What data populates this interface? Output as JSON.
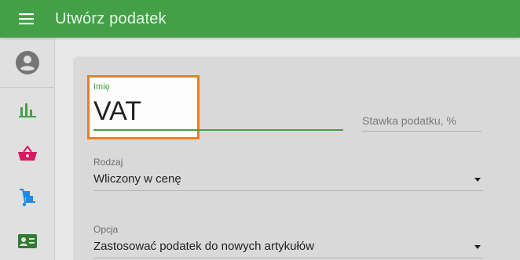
{
  "header": {
    "title": "Utwórz podatek",
    "menu_icon": "hamburger-menu-icon",
    "background_color": "#43a047"
  },
  "sidebar": {
    "avatar_icon": "account-circle-icon",
    "items": [
      {
        "icon": "bar-chart-icon",
        "color": "#43a047"
      },
      {
        "icon": "shopping-basket-icon",
        "color": "#d81b60"
      },
      {
        "icon": "hand-truck-icon",
        "color": "#1e88e5"
      },
      {
        "icon": "contact-card-icon",
        "color": "#2e7d32"
      }
    ]
  },
  "form": {
    "name": {
      "label": "Imię",
      "value": "VAT"
    },
    "rate": {
      "placeholder": "Stawka podatku, %"
    },
    "type": {
      "label": "Rodzaj",
      "value": "Wliczony w cenę"
    },
    "option": {
      "label": "Opcja",
      "value": "Zastosować podatek do nowych artykułów"
    }
  },
  "highlight_color": "#ef7d22"
}
